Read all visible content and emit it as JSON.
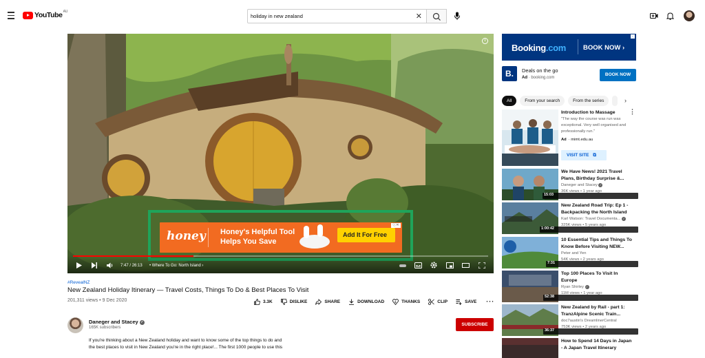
{
  "header": {
    "logo_text": "YouTube",
    "country_code": "AU",
    "search_value": "holiday in new zealand"
  },
  "player": {
    "time_current": "7:47",
    "time_total": "26:13",
    "chapter": "Where To Go: North Island",
    "progress": 0.29,
    "ad": {
      "brand": "honey",
      "headline_1": "Honey's Helpful Tool",
      "headline_2": "Helps You Save",
      "cta": "Add It For Free"
    }
  },
  "video": {
    "hashtag": "#RevealNZ",
    "title": "New Zealand Holiday Itinerary — Travel Costs, Things To Do & Best Places To Visit",
    "stats": "201,311 views • 9 Dec 2020",
    "actions": {
      "likes": "3.3K",
      "dislike": "DISLIKE",
      "share": "SHARE",
      "download": "DOWNLOAD",
      "thanks": "THANKS",
      "clip": "CLIP",
      "save": "SAVE"
    },
    "channel": {
      "name": "Daneger and Stacey",
      "subs": "165K subscribers",
      "subscribe": "SUBSCRIBE"
    },
    "description_1": "If you're thinking about a New Zealand holiday and want to know some of the top things to do and",
    "description_2": "the best places to visit in New Zealand you're in the right place!... The first 1000 people to use this"
  },
  "sidebar": {
    "top_ad": {
      "brand_a": "Booking",
      "brand_b": ".com",
      "cta_banner": "BOOK NOW ›",
      "logo_letter": "B.",
      "deal": "Deals on the go",
      "ad_label": "Ad",
      "site": "booking.com",
      "cta": "BOOK NOW"
    },
    "chips": [
      "All",
      "From your search",
      "From the series"
    ],
    "promo": {
      "title": "Introduction to Massage",
      "quote": "\"The way the course was run was exceptional. Very well organised and professionally run.\"",
      "ad_label": "Ad",
      "site": "mimt.edu.au",
      "visit": "VISIT SITE"
    },
    "videos": [
      {
        "title": "We Have News! 2021 Travel Plans, Birthday Surprise &...",
        "channel": "Daneger and Stacey",
        "views": "36K views • 1 year ago",
        "duration": "15:03"
      },
      {
        "title": "New Zealand Road Trip: Ep 1 - Backpacking the North Island",
        "channel": "Karl Watson: Travel Documenta...",
        "views": "325K views • 5 years ago",
        "duration": "1:00:42"
      },
      {
        "title": "10 Essential Tips and Things To Know Before Visiting NEW...",
        "channel": "Peter and Yen",
        "views": "54K views • 2 years ago",
        "duration": "7:31"
      },
      {
        "title": "Top 100 Places To Visit In Europe",
        "channel": "Ryan Shirley",
        "views": "11M views • 1 year ago",
        "duration": "52:38"
      },
      {
        "title": "New Zealand by Rail - part 1: TranzAlpine Scenic Train...",
        "channel": "doc7austin's DreamlinerCentral",
        "views": "753K views • 2 years ago",
        "duration": "36:37"
      },
      {
        "title": "How to Spend 14 Days in Japan - A Japan Travel Itinerary",
        "channel": "",
        "views": "",
        "duration": ""
      }
    ]
  }
}
